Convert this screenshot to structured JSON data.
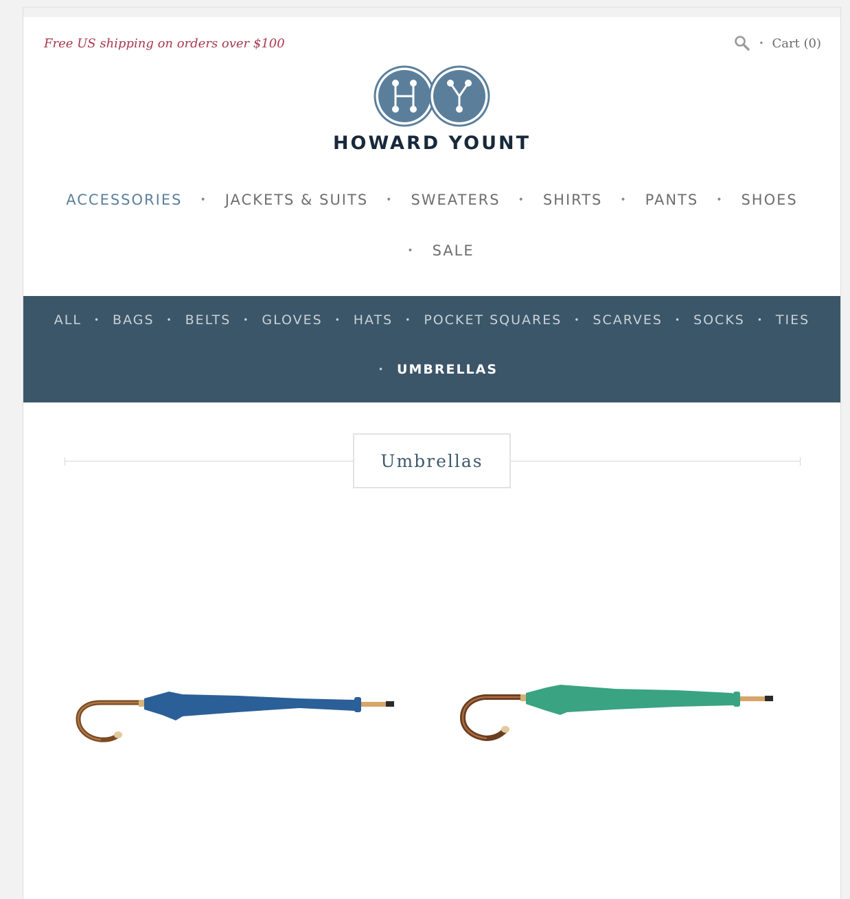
{
  "promo": {
    "text": "Free US shipping on orders over $100"
  },
  "utility": {
    "search_icon": "search-icon",
    "cart_label": "Cart (0)"
  },
  "brand": {
    "name": "HOWARD YOUNT",
    "monogram_left": "H",
    "monogram_right": "Y",
    "color": "#5b7f9b"
  },
  "main_nav": {
    "items": [
      {
        "label": "ACCESSORIES",
        "active": true
      },
      {
        "label": "JACKETS & SUITS"
      },
      {
        "label": "SWEATERS"
      },
      {
        "label": "SHIRTS"
      },
      {
        "label": "PANTS"
      },
      {
        "label": "SHOES"
      },
      {
        "label": "SALE"
      }
    ],
    "active_color": "#5b7f9b"
  },
  "sub_nav": {
    "background": "#3c5669",
    "items": [
      {
        "label": "ALL"
      },
      {
        "label": "BAGS"
      },
      {
        "label": "BELTS"
      },
      {
        "label": "GLOVES"
      },
      {
        "label": "HATS"
      },
      {
        "label": "POCKET SQUARES"
      },
      {
        "label": "SCARVES"
      },
      {
        "label": "SOCKS"
      },
      {
        "label": "TIES"
      },
      {
        "label": "UMBRELLAS",
        "current": true
      }
    ]
  },
  "collection": {
    "title": "Umbrellas"
  },
  "products": [
    {
      "canopy_color": "#2b5f98"
    },
    {
      "canopy_color": "#3aa382"
    }
  ]
}
